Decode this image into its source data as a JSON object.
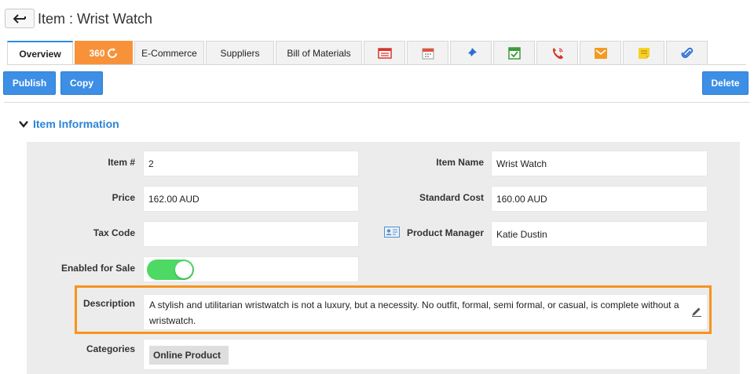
{
  "header": {
    "title": "Item : Wrist Watch"
  },
  "tabs": [
    {
      "label": "Overview"
    },
    {
      "label": "360"
    },
    {
      "label": "E-Commerce"
    },
    {
      "label": "Suppliers"
    },
    {
      "label": "Bill of Materials"
    }
  ],
  "tab_icons": [
    "report-icon",
    "calendar-icon",
    "pin-icon",
    "task-icon",
    "phone-icon",
    "email-icon",
    "note-icon",
    "attachment-icon"
  ],
  "toolbar": {
    "publish_label": "Publish",
    "copy_label": "Copy",
    "delete_label": "Delete"
  },
  "section": {
    "title": "Item Information"
  },
  "fields": {
    "item_no_label": "Item #",
    "item_no": "2",
    "item_name_label": "Item Name",
    "item_name": "Wrist Watch",
    "price_label": "Price",
    "price": "162.00  AUD",
    "standard_cost_label": "Standard Cost",
    "standard_cost": "160.00  AUD",
    "tax_code_label": "Tax Code",
    "tax_code": "",
    "product_manager_label": "Product Manager",
    "product_manager": "Katie Dustin",
    "enabled_for_sale_label": "Enabled for Sale",
    "enabled_for_sale": true,
    "description_label": "Description",
    "description": "A stylish and utilitarian wristwatch is not a luxury, but a necessity. No outfit, formal, semi formal, or casual, is complete without a wristwatch.",
    "categories_label": "Categories",
    "categories": [
      "Online Product"
    ]
  },
  "colors": {
    "accent": "#3d8fe6",
    "orange": "#f7923a",
    "toggle_on": "#4cd964",
    "highlight": "#f7931e"
  }
}
